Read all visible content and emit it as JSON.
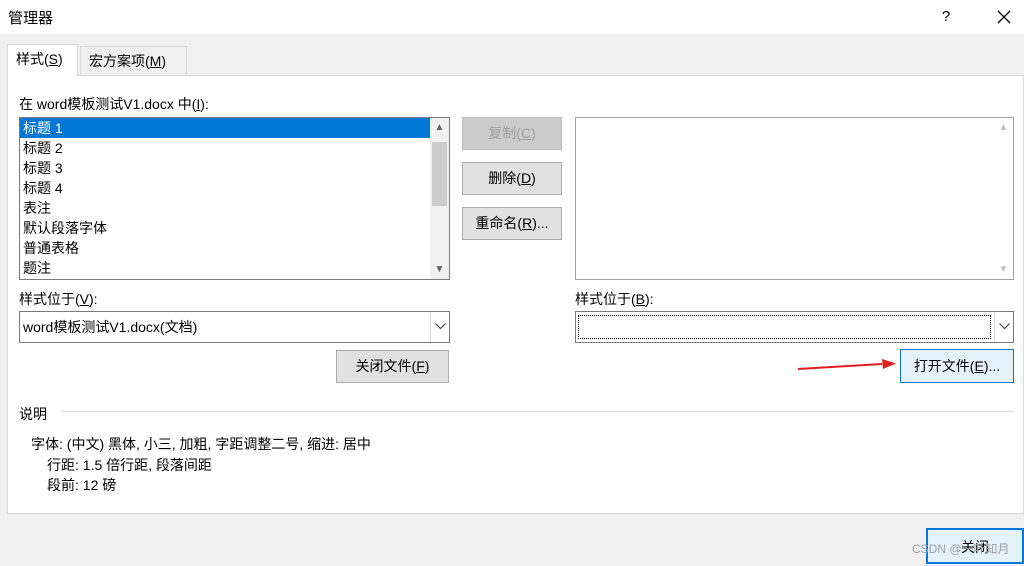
{
  "window": {
    "title": "管理器",
    "help_label": "?"
  },
  "tabs": [
    {
      "label": "样式(",
      "key": "S",
      "suffix": ")"
    },
    {
      "label": "宏方案项(",
      "key": "M",
      "suffix": ")"
    }
  ],
  "left": {
    "in_label_prefix": "在 word模板测试V1.docx 中(",
    "in_label_key": "I",
    "in_label_suffix": "):",
    "items": [
      "标题 1",
      "标题 2",
      "标题 3",
      "标题 4",
      "表注",
      "默认段落字体",
      "普通表格",
      "题注"
    ],
    "selected_index": 0,
    "location_prefix": "样式位于(",
    "location_key": "V",
    "location_suffix": "):",
    "location_value": "word模板测试V1.docx(文档)",
    "close_file_prefix": "关闭文件(",
    "close_file_key": "F",
    "close_file_suffix": ")"
  },
  "middle": {
    "copy_prefix": "复制(",
    "copy_key": "C",
    "copy_suffix": ")",
    "delete_prefix": "删除(",
    "delete_key": "D",
    "delete_suffix": ")",
    "rename_prefix": "重命名(",
    "rename_key": "R",
    "rename_suffix": ")..."
  },
  "right": {
    "location_prefix": "样式位于(",
    "location_key": "B",
    "location_suffix": "):",
    "location_value": "",
    "open_file_prefix": "打开文件(",
    "open_file_key": "E",
    "open_file_suffix": ")..."
  },
  "description": {
    "heading": "说明",
    "line1": "字体: (中文) 黑体, 小三, 加粗, 字距调整二号, 缩进: 居中",
    "line2": "行距: 1.5 倍行距, 段落间距",
    "line3": "段前: 12 磅"
  },
  "footer": {
    "close_label": "关闭",
    "watermark": "CSDN @一叶知月"
  },
  "colors": {
    "selection": "#0078d7",
    "annotation_arrow": "#e02020"
  },
  "icons": {
    "close": "close-icon",
    "dropdown": "chevron-down-icon",
    "scroll_up": "scroll-up-icon",
    "scroll_down": "scroll-down-icon"
  }
}
